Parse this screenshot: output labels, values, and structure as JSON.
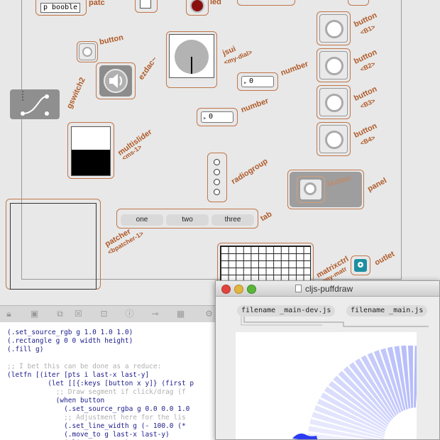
{
  "patcher": {
    "objects": {
      "object_box": "p booble",
      "number1_value": "0",
      "number2_value": "0"
    },
    "labels": {
      "button": "button",
      "ezdac": "ezdac~",
      "gswitch": "gswitch2",
      "multislider": "multislider",
      "multislider_sub": "<ms-1>",
      "jsui": "jsui",
      "jsui_sub": "<my-dial>",
      "number1": "number",
      "number2": "number",
      "radiogroup": "radiogroup",
      "tab": "tab",
      "patcher": "patcher",
      "patcher_sub": "<bpatcher-1>",
      "matrixctrl": "matrixctrl",
      "matrixctrl_sub": "<my-matr",
      "outlet": "outlet",
      "panel": "panel",
      "panel_button": "button",
      "b1": "button",
      "b1_sub": "<B1>",
      "b2": "button",
      "b2_sub": "<B2>",
      "b3": "button",
      "b3_sub": "<B3>",
      "b4": "button",
      "b4_sub": "<B4>",
      "top_patch": "patc",
      "top_led": "led"
    },
    "tabs": [
      "one",
      "two",
      "three"
    ]
  },
  "code": {
    "lines": [
      {
        "text": "(.set_source_rgb g 1.0 1.0 1.0)",
        "comment": false
      },
      {
        "text": "(.rectangle g 0 0 width height)",
        "comment": false
      },
      {
        "text": "(.fill g)",
        "comment": false
      },
      {
        "text": "",
        "comment": false
      },
      {
        "text": ";; I bet this can be done as a reduce:",
        "comment": true
      },
      {
        "text": "(letfn [(iter [pts i last-x last-y]",
        "comment": false
      },
      {
        "text": "          (let [[{:keys [button x y]} (first p",
        "comment": false
      },
      {
        "text": "            ;; Draw segment if click/drag (f",
        "comment": true
      },
      {
        "text": "            (when button",
        "comment": false
      },
      {
        "text": "              (.set_source_rgba g 0.0 0.0 1.0",
        "comment": false
      },
      {
        "text": "              ;; Adjustment here for the lis",
        "comment": true
      },
      {
        "text": "              (.set_line_width g (- 100.0 (*",
        "comment": false
      },
      {
        "text": "              (.move_to g last-x last-y)",
        "comment": false
      },
      {
        "text": "              (.line_to g x y)",
        "comment": false
      }
    ]
  },
  "window": {
    "title": "cljs-puffdraw",
    "file_dev": "filename _main-dev.js",
    "file_main": "filename _main.js"
  },
  "colors": {
    "accent_label": "#b05a28",
    "draw_blue": "#2b3df0"
  },
  "icons": [
    "lock-icon",
    "presentation-icon",
    "connect-icon",
    "clear-icon",
    "chart-icon",
    "info-icon",
    "slider-icon",
    "grid-icon",
    "gear-icon"
  ]
}
